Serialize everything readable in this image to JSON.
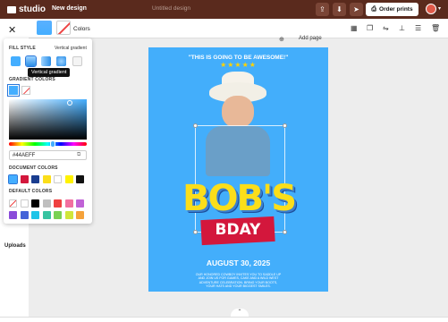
{
  "app": {
    "logo_text": "studio",
    "menu": "New design",
    "design_title": "Untitled design",
    "order_button": "Order prints"
  },
  "toolbar": {
    "colors_label": "Colors",
    "add_page": "Add page"
  },
  "sidebar": {
    "uploads_label": "Uploads"
  },
  "fill_panel": {
    "fill_style_label": "FILL STYLE",
    "fill_style_value": "Vertical gradient",
    "tooltip": "Vertical gradient",
    "gradient_label": "GRADIENT COLORS",
    "hex_value": "#44AEFF",
    "document_colors_label": "DOCUMENT COLORS",
    "document_colors": [
      "#44aeff",
      "#d3173c",
      "#1a3d8f",
      "#fbde1a",
      "#ffffff",
      "#fff200",
      "#111111"
    ],
    "default_colors_label": "DEFAULT COLORS",
    "default_colors_row1": [
      "none",
      "#ffffff",
      "#000000",
      "#bfbfbf",
      "#ef4040",
      "#f26fa0",
      "#c062d6"
    ],
    "default_colors_row2": [
      "#8a4bd9",
      "#4463d8",
      "#1fc4e8",
      "#37c3a1",
      "#79d154",
      "#d0e63a",
      "#f5a23a"
    ]
  },
  "poster": {
    "tagline": "\"THIS IS GOING TO BE AWESOME!\"",
    "stars": "★★★★★",
    "headline": "BOB'S",
    "subheadline": "BDAY",
    "date": "AUGUST 30, 2025",
    "fine_print": "OUR HONORED COWBOY INVITES YOU TO SADDLE UP AND JOIN US FOR GAMES, CAKE AND A WILD WEST ADVENTURE CELEBRATION. BRING YOUR BOOTS, YOUR HATS AND YOUR BIGGEST SMILES."
  },
  "colors": {
    "accent": "#44aeff",
    "topbar": "#5a2a1d"
  }
}
